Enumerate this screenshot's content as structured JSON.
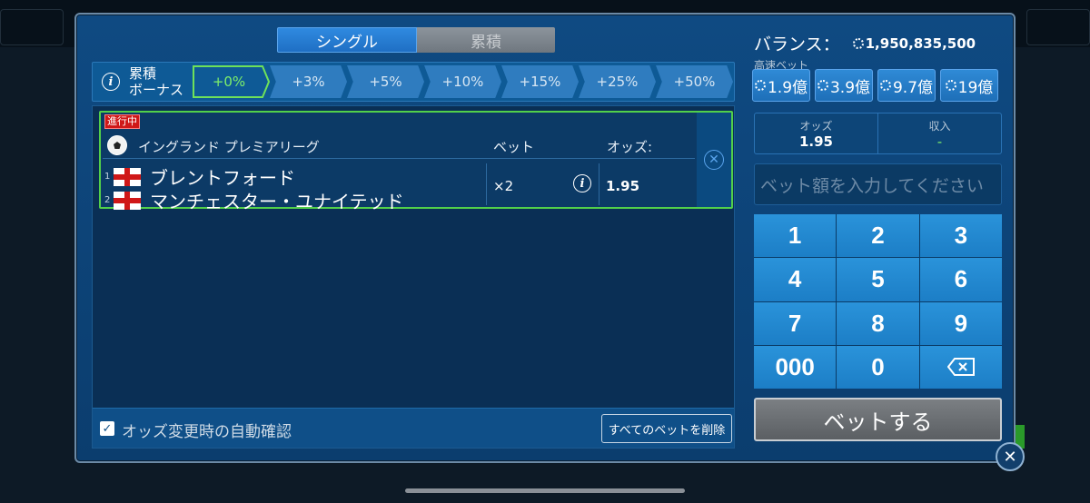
{
  "tabs": [
    {
      "label": "シングル",
      "active": true
    },
    {
      "label": "累積",
      "active": false
    }
  ],
  "bonus": {
    "label_line1": "累積",
    "label_line2": "ボーナス",
    "steps": [
      "+0%",
      "+3%",
      "+5%",
      "+10%",
      "+15%",
      "+25%",
      "+50%"
    ],
    "active_index": 0,
    "active_color": "#6ee15a"
  },
  "bet": {
    "status": "進行中",
    "league": "イングランド プレミアリーグ",
    "col_bet": "ベット",
    "col_odds": "オッズ:",
    "teams": [
      {
        "num": "1",
        "name": "ブレントフォード"
      },
      {
        "num": "2",
        "name": "マンチェスター・ユナイテッド"
      }
    ],
    "multiplier": "×2",
    "odds": "1.95"
  },
  "footer": {
    "auto_confirm_label": "オッズ変更時の自動確認",
    "auto_confirm_checked": true,
    "delete_all_label": "すべてのベットを削除"
  },
  "balance": {
    "label": "バランス：",
    "value": "1,950,835,500"
  },
  "quick_bet": {
    "label": "高速ベット",
    "options": [
      "1.9億",
      "3.9億",
      "9.7億",
      "19億"
    ]
  },
  "summary": {
    "odds_label": "オッズ",
    "odds_value": "1.95",
    "income_label": "収入",
    "income_value": "-"
  },
  "amount_input": {
    "placeholder": "ベット額を入力してください"
  },
  "keypad": [
    "1",
    "2",
    "3",
    "4",
    "5",
    "6",
    "7",
    "8",
    "9",
    "000",
    "0",
    "backspace"
  ],
  "bet_button": "ベットする",
  "icons": {
    "info": "info-icon",
    "remove": "remove-icon",
    "close": "close-icon",
    "backspace": "backspace-icon",
    "soccer": "soccer-ball-icon",
    "flag": "england-flag-icon"
  }
}
